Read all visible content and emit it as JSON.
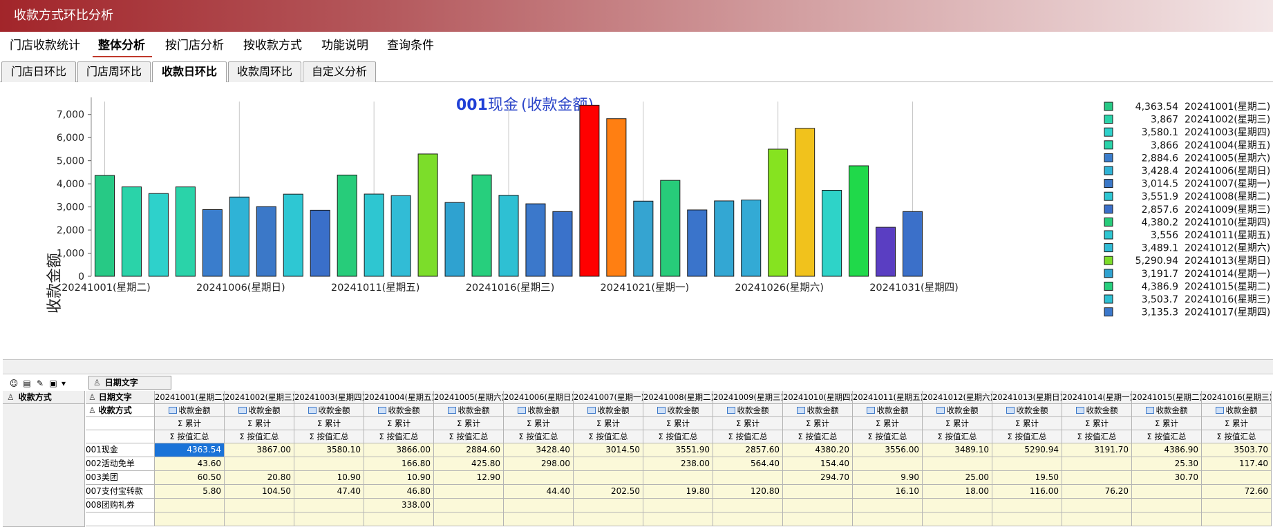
{
  "window": {
    "title": "收款方式环比分析"
  },
  "menu": {
    "items": [
      "门店收款统计",
      "整体分析",
      "按门店分析",
      "按收款方式",
      "功能说明",
      "查询条件"
    ],
    "active_index": 1
  },
  "tabs": {
    "items": [
      "门店日环比",
      "门店周环比",
      "收款日环比",
      "收款周环比",
      "自定义分析"
    ],
    "active_index": 2
  },
  "chart_data": {
    "type": "bar",
    "title_code": "001",
    "title_name": "现金",
    "title_suffix": "(收款金额)",
    "ylabel": "收款金额",
    "ylim": [
      0,
      7500
    ],
    "yticks": [
      "0",
      "1,000",
      "2,000",
      "3,000",
      "4,000",
      "5,000",
      "6,000",
      "7,000"
    ],
    "xtick_labels": [
      "20241001(星期二)",
      "20241006(星期日)",
      "20241011(星期五)",
      "20241016(星期三)",
      "20241021(星期一)",
      "20241026(星期六)",
      "20241031(星期四)"
    ],
    "xtick_indices": [
      0,
      5,
      10,
      15,
      20,
      25,
      30
    ],
    "values": [
      4363.54,
      3867,
      3580.1,
      3866,
      2884.6,
      3428.4,
      3014.5,
      3551.9,
      2857.6,
      4380.2,
      3556,
      3489.1,
      5290.94,
      3191.7,
      4386.9,
      3503.7,
      3135.3,
      2800,
      7400,
      6820,
      3250,
      4150,
      2870,
      3260,
      3300,
      5500,
      6400,
      3720,
      4780,
      2120,
      2800
    ],
    "colors": [
      "#27c985",
      "#2ad3a9",
      "#2ed1cb",
      "#2ad3a9",
      "#3a7dcc",
      "#2fb3d6",
      "#3b78c8",
      "#2ec7d3",
      "#3a6fc9",
      "#27cc7a",
      "#2ec6d1",
      "#31bcd6",
      "#7cdd2a",
      "#2fa2d0",
      "#27cf7d",
      "#2ec0d3",
      "#3b78cb",
      "#3a72ca",
      "#ff0000",
      "#ff7f12",
      "#35a4d1",
      "#27cc7a",
      "#3a74cb",
      "#33a7d3",
      "#33aad5",
      "#86e320",
      "#f1c21c",
      "#2ed3c8",
      "#20d94a",
      "#5a3ec2",
      "#3b70c9"
    ],
    "legend": [
      {
        "value": "4,363.54",
        "label": "20241001(星期二)"
      },
      {
        "value": "3,867",
        "label": "20241002(星期三)"
      },
      {
        "value": "3,580.1",
        "label": "20241003(星期四)"
      },
      {
        "value": "3,866",
        "label": "20241004(星期五)"
      },
      {
        "value": "2,884.6",
        "label": "20241005(星期六)"
      },
      {
        "value": "3,428.4",
        "label": "20241006(星期日)"
      },
      {
        "value": "3,014.5",
        "label": "20241007(星期一)"
      },
      {
        "value": "3,551.9",
        "label": "20241008(星期二)"
      },
      {
        "value": "2,857.6",
        "label": "20241009(星期三)"
      },
      {
        "value": "4,380.2",
        "label": "20241010(星期四)"
      },
      {
        "value": "3,556",
        "label": "20241011(星期五)"
      },
      {
        "value": "3,489.1",
        "label": "20241012(星期六)"
      },
      {
        "value": "5,290.94",
        "label": "20241013(星期日)"
      },
      {
        "value": "3,191.7",
        "label": "20241014(星期一)"
      },
      {
        "value": "4,386.9",
        "label": "20241015(星期二)"
      },
      {
        "value": "3,503.7",
        "label": "20241016(星期三)"
      },
      {
        "value": "3,135.3",
        "label": "20241017(星期四)"
      }
    ],
    "legend_placement": "right",
    "grid": "vertical"
  },
  "pivot": {
    "filter_field": "日期文字",
    "row_field": "收款方式",
    "col_field": "日期文字",
    "measure": "收款金额",
    "sum_label": "Σ 累计",
    "agg_label": "Σ 按值汇总",
    "dates": [
      "20241001(星期二)",
      "20241002(星期三)",
      "20241003(星期四)",
      "20241004(星期五)",
      "20241005(星期六)",
      "20241006(星期日)",
      "20241007(星期一)",
      "20241008(星期二)",
      "20241009(星期三)",
      "20241010(星期四)",
      "20241011(星期五)",
      "20241012(星期六)",
      "20241013(星期日)",
      "20241014(星期一)",
      "20241015(星期二)",
      "20241016(星期三)"
    ],
    "rows": [
      {
        "name": "001现金",
        "values": [
          "4363.54",
          "3867.00",
          "3580.10",
          "3866.00",
          "2884.60",
          "3428.40",
          "3014.50",
          "3551.90",
          "2857.60",
          "4380.20",
          "3556.00",
          "3489.10",
          "5290.94",
          "3191.70",
          "4386.90",
          "3503.70"
        ]
      },
      {
        "name": "002活动免单",
        "values": [
          "43.60",
          "",
          "",
          "166.80",
          "425.80",
          "298.00",
          "",
          "238.00",
          "564.40",
          "154.40",
          "",
          "",
          "",
          "",
          "25.30",
          "117.40"
        ]
      },
      {
        "name": "003美团",
        "values": [
          "60.50",
          "20.80",
          "10.90",
          "10.90",
          "12.90",
          "",
          "",
          "",
          "",
          "294.70",
          "9.90",
          "25.00",
          "19.50",
          "",
          "30.70",
          ""
        ]
      },
      {
        "name": "007支付宝转款",
        "values": [
          "5.80",
          "104.50",
          "47.40",
          "46.80",
          "",
          "44.40",
          "202.50",
          "19.80",
          "120.80",
          "",
          "16.10",
          "18.00",
          "116.00",
          "76.20",
          "",
          "72.60"
        ]
      },
      {
        "name": "008团购礼券",
        "values": [
          "",
          "",
          "",
          "338.00",
          "",
          "",
          "",
          "",
          "",
          "",
          "",
          "",
          "",
          "",
          "",
          ""
        ]
      }
    ]
  }
}
